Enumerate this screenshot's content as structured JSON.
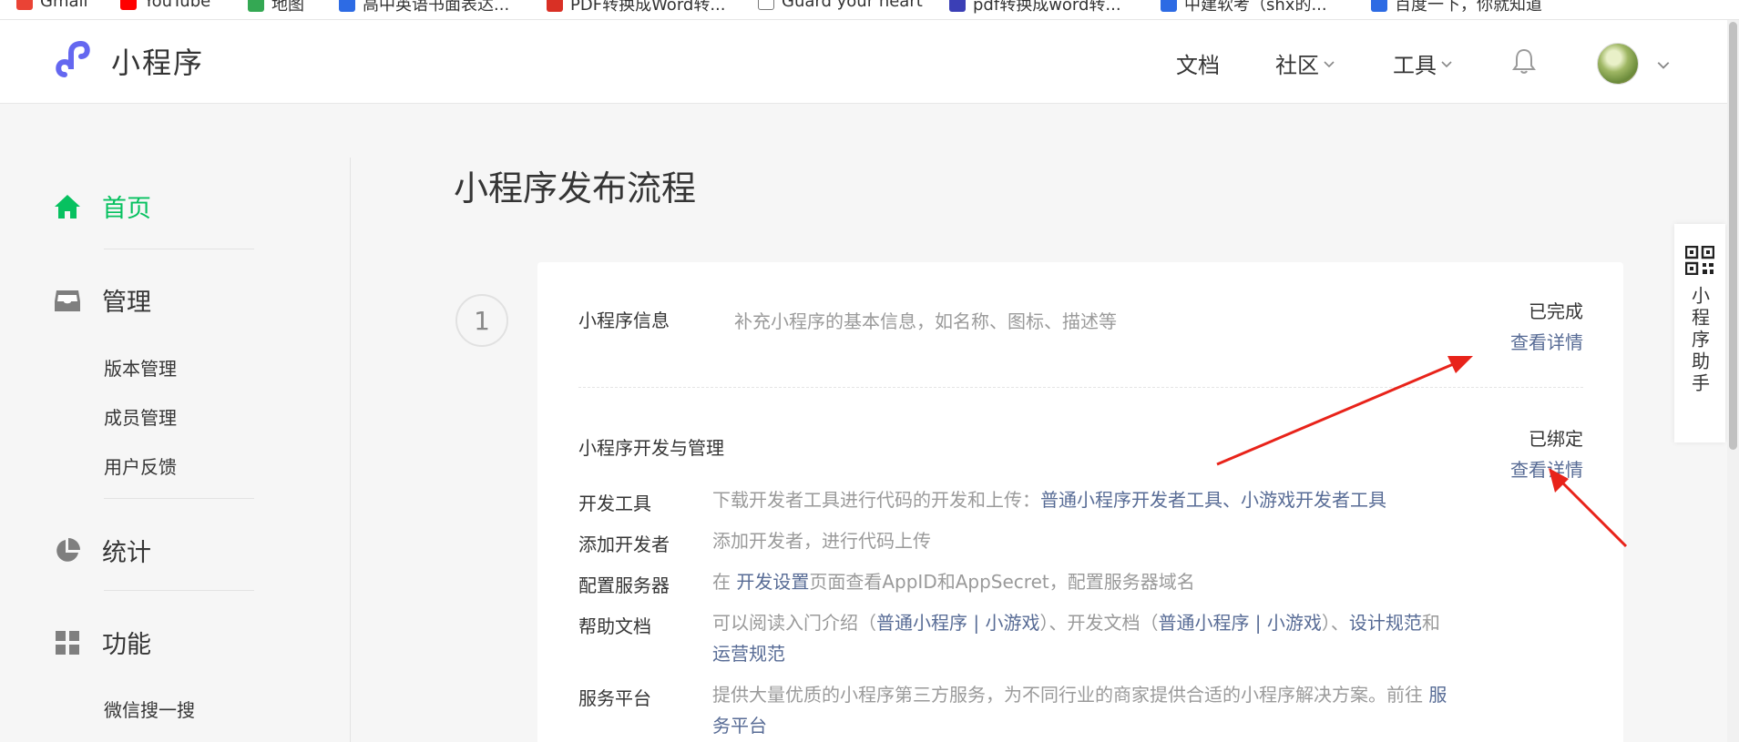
{
  "bookmarks": [
    {
      "label": "Gmail",
      "color": "#ea4335"
    },
    {
      "label": "YouTube",
      "color": "#ff0000"
    },
    {
      "label": "地图",
      "color": "#34a853"
    },
    {
      "label": "高中英语书面表达...",
      "color": "#2d6be4"
    },
    {
      "label": "PDF转换成Word转...",
      "color": "#d93025"
    },
    {
      "label": "Guard your heart",
      "color": "#555555"
    },
    {
      "label": "pdf转换成word转...",
      "color": "#3b3fb6"
    },
    {
      "label": "中建软考（shx的...",
      "color": "#2d6be4"
    },
    {
      "label": "百度一下，你就知道",
      "color": "#2d6be4"
    }
  ],
  "header": {
    "logo_text": "小程序",
    "nav": {
      "docs": "文档",
      "community": "社区",
      "tools": "工具"
    },
    "brand_color": "#6467f0"
  },
  "sidebar": {
    "home": "首页",
    "manage": "管理",
    "manage_items": [
      "版本管理",
      "成员管理",
      "用户反馈"
    ],
    "stats": "统计",
    "features": "功能",
    "features_items": [
      "微信搜一搜"
    ],
    "active_color": "#07c160"
  },
  "main": {
    "title": "小程序发布流程",
    "step_number": "1",
    "info_row": {
      "title": "小程序信息",
      "desc": "补充小程序的基本信息，如名称、图标、描述等",
      "status": "已完成",
      "detail_link": "查看详情"
    },
    "dev_row": {
      "title": "小程序开发与管理",
      "status": "已绑定",
      "detail_link": "查看详情",
      "items": {
        "tools_label": "开发工具",
        "tools_text": "下载开发者工具进行代码的开发和上传：",
        "tools_link1": "普通小程序开发者工具",
        "tools_sep": "、",
        "tools_link2": "小游戏开发者工具",
        "adddev_label": "添加开发者",
        "adddev_text": "添加开发者，进行代码上传",
        "server_label": "配置服务器",
        "server_pre": "在",
        "server_link": "开发设置",
        "server_post": "页面查看AppID和AppSecret，配置服务器域名",
        "help_label": "帮助文档",
        "help_t1": "可以阅读入门介绍（",
        "help_l1": "普通小程序",
        "help_bar1": " | ",
        "help_l2": "小游戏",
        "help_t2": "）、开发文档（",
        "help_l3": "普通小程序",
        "help_bar2": " | ",
        "help_l4": "小游戏",
        "help_t3": "）、",
        "help_l5": "设计规范",
        "help_t4": "和",
        "help_l6": "运营规范",
        "platform_label": "服务平台",
        "platform_text": "提供大量优质的小程序第三方服务，为不同行业的商家提供合适的小程序解决方案。前往",
        "platform_link": "服务平台"
      }
    }
  },
  "helper": {
    "label": "小程序助手"
  },
  "annotation_color": "#e8231a",
  "link_color": "#576b95"
}
